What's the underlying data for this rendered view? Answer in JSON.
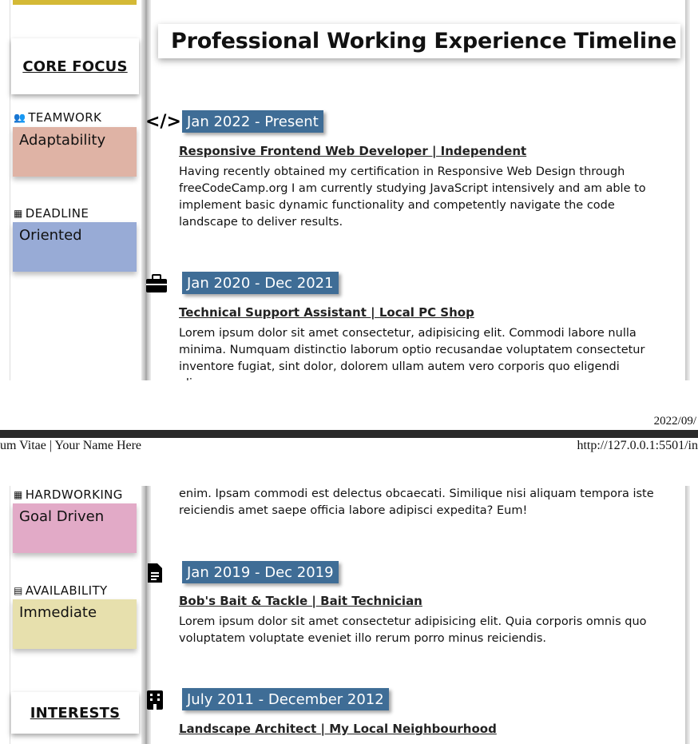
{
  "sidebar": {
    "core_focus_heading": "CORE FOCUS",
    "interests_heading": "INTERESTS",
    "traits": [
      {
        "tag": "TEAMWORK",
        "icon": "users-icon",
        "value": "Adaptability",
        "color": "#dfb3a5"
      },
      {
        "tag": "DEADLINE",
        "icon": "calendar-icon",
        "value": "Oriented",
        "color": "#98abd6"
      },
      {
        "tag": "HARDWORKING",
        "icon": "building-icon",
        "value": "Goal Driven",
        "color": "#e2aac7"
      },
      {
        "tag": "AVAILABILITY",
        "icon": "chart-icon",
        "value": "Immediate",
        "color": "#e7e0ad"
      }
    ]
  },
  "timeline": {
    "title": "Professional Working Experience Timeline",
    "entries": [
      {
        "icon": "code-icon",
        "date": "Jan 2022 - Present",
        "role": "Responsive Frontend Web Developer | Independent",
        "description": "Having recently obtained my certification in Responsive Web Design through freeCodeCamp.org I am currently studying JavaScript intensively and am able to implement basic dynamic functionality and competently navigate the code landscape to deliver results."
      },
      {
        "icon": "briefcase-icon",
        "date": "Jan 2020 - Dec 2021",
        "role": "Technical Support Assistant | Local PC Shop",
        "description_part1": "Lorem ipsum dolor sit amet consectetur, adipisicing elit. Commodi labore nulla minima. Numquam distinctio laborum optio recusandae voluptatem consectetur inventore fugiat, sint dolor, dolorem ullam autem vero corporis quo eligendi aliquam",
        "description_part2": "enim. Ipsam commodi est delectus obcaecati. Similique nisi aliquam tempora iste reiciendis amet saepe officia labore adipisci expedita? Eum!"
      },
      {
        "icon": "document-icon",
        "date": "Jan 2019 - Dec 2019",
        "role": "Bob's Bait & Tackle | Bait Technician",
        "description": "Lorem ipsum dolor sit amet consectetur adipisicing elit. Quia corporis omnis quo voluptatem voluptate eveniet illo rerum porro minus reiciendis."
      },
      {
        "icon": "building-icon",
        "date": "July 2011 - December 2012",
        "role": "Landscape Architect | My Local Neighbourhood"
      }
    ]
  },
  "print_header": {
    "date": "2022/09/",
    "title": "um Vitae | Your Name Here",
    "url": "http://127.0.0.1:5501/in"
  }
}
